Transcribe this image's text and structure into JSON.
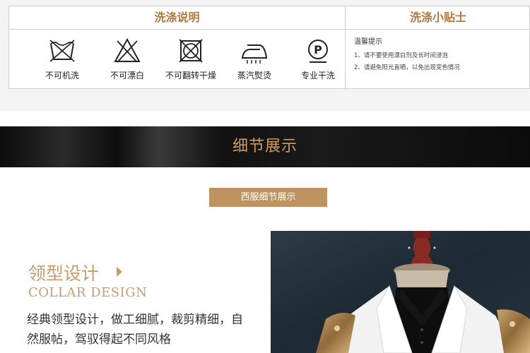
{
  "care": {
    "left_header": "洗涤说明",
    "right_header": "洗涤小贴士",
    "items": [
      {
        "label": "不可机洗",
        "icon": "no-machine-wash-icon"
      },
      {
        "label": "不可漂白",
        "icon": "no-bleach-icon"
      },
      {
        "label": "不可翻转干燥",
        "icon": "no-tumble-dry-icon"
      },
      {
        "label": "蒸汽熨烫",
        "icon": "steam-iron-icon"
      },
      {
        "label": "专业干洗",
        "icon": "professional-dry-clean-icon"
      }
    ],
    "tips_title": "温馨提示",
    "tips": [
      "1、请不要使用漂白剂及长时间浸泡",
      "2、请避免阳光直晒，以免出现变色情况"
    ]
  },
  "banner": {
    "title": "细节展示"
  },
  "tag": {
    "label": "西服细节展示"
  },
  "collar": {
    "title_cn": "领型设计",
    "title_en": "COLLAR DESIGN",
    "description": "经典领型设计，做工细腻，裁剪精细，自然服帖，驾驭得起不同风格"
  },
  "colors": {
    "accent": "#c89b6c",
    "tag_bg": "#bd9460",
    "banner_bg": "#0d0d0d"
  }
}
